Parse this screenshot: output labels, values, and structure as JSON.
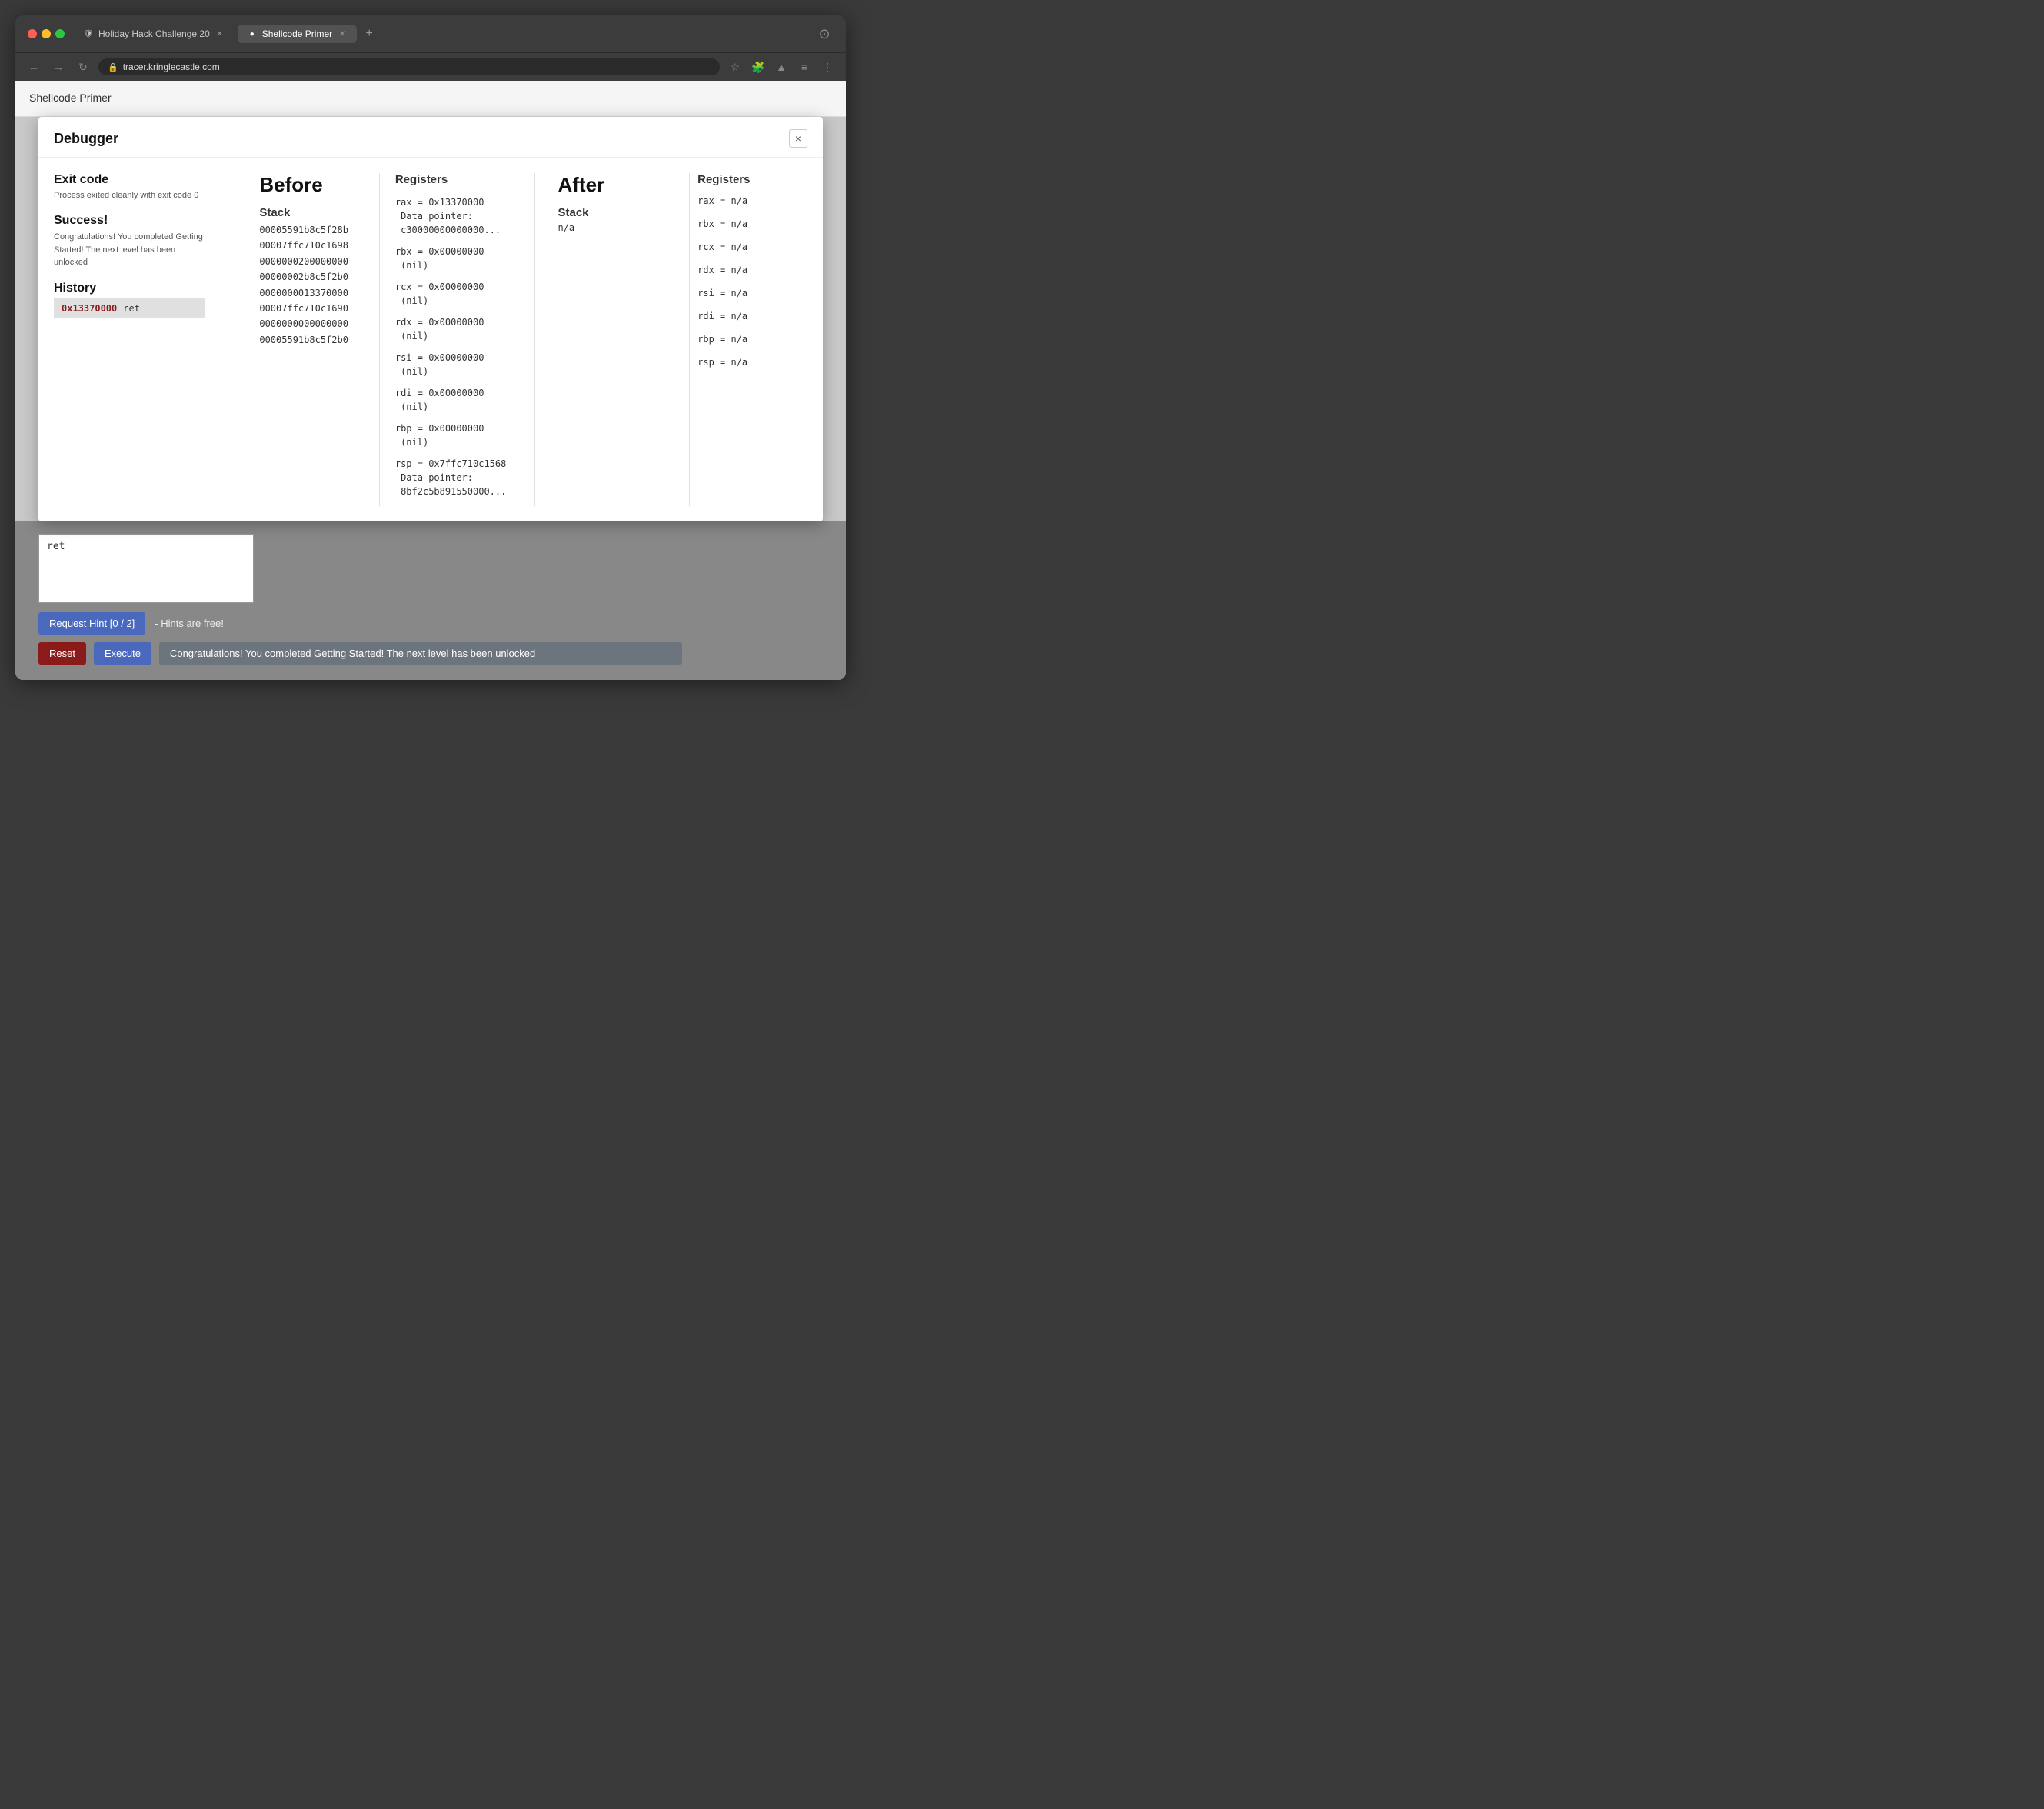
{
  "browser": {
    "tab1": {
      "label": "Holiday Hack Challenge 20",
      "favicon": "🛡",
      "active": false
    },
    "tab2": {
      "label": "Shellcode Primer",
      "favicon": "🔵",
      "active": true
    },
    "address": "tracer.kringlecastle.com",
    "nav": {
      "back": "←",
      "forward": "→",
      "reload": "↻"
    }
  },
  "sidebar": {
    "title": "Shellcode Primer"
  },
  "debugger": {
    "title": "Debugger",
    "close_label": "×",
    "exit_code": {
      "label": "Exit code",
      "value": "Process exited cleanly with exit code 0"
    },
    "success": {
      "label": "Success!",
      "value": "Congratulations! You completed Getting Started! The next level has been unlocked"
    },
    "history": {
      "label": "History",
      "items": [
        {
          "addr": "0x13370000",
          "instruction": "ret"
        }
      ]
    },
    "before": {
      "title": "Before",
      "stack_label": "Stack",
      "stack_values": [
        "00005591b8c5f28b",
        "00007ffc710c1698",
        "0000000200000000",
        "00000002b8c5f2b0",
        "0000000013370000",
        "00007ffc710c1690",
        "0000000000000000",
        "00005591b8c5f2b0"
      ]
    },
    "registers_before": {
      "label": "Registers",
      "entries": [
        {
          "name": "rax",
          "value": "0x13370000",
          "note": "Data pointer:",
          "data": "c30000000000000..."
        },
        {
          "name": "rbx",
          "value": "0x00000000",
          "note": "(nil)",
          "data": ""
        },
        {
          "name": "rcx",
          "value": "0x00000000",
          "note": "(nil)",
          "data": ""
        },
        {
          "name": "rdx",
          "value": "0x00000000",
          "note": "(nil)",
          "data": ""
        },
        {
          "name": "rsi",
          "value": "0x00000000",
          "note": "(nil)",
          "data": ""
        },
        {
          "name": "rdi",
          "value": "0x00000000",
          "note": "(nil)",
          "data": ""
        },
        {
          "name": "rbp",
          "value": "0x00000000",
          "note": "(nil)",
          "data": ""
        },
        {
          "name": "rsp",
          "value": "0x7ffc710c1568",
          "note": "Data pointer:",
          "data": "8bf2c5b891550000..."
        }
      ]
    },
    "after": {
      "title": "After",
      "stack_label": "Stack",
      "stack_value": "n/a"
    },
    "registers_after": {
      "label": "Registers",
      "entries": [
        {
          "name": "rax",
          "value": "n/a"
        },
        {
          "name": "rbx",
          "value": "n/a"
        },
        {
          "name": "rcx",
          "value": "n/a"
        },
        {
          "name": "rdx",
          "value": "n/a"
        },
        {
          "name": "rsi",
          "value": "n/a"
        },
        {
          "name": "rdi",
          "value": "n/a"
        },
        {
          "name": "rbp",
          "value": "n/a"
        },
        {
          "name": "rsp",
          "value": "n/a"
        }
      ]
    }
  },
  "bottom": {
    "code_value": "ret",
    "hint_btn": "Request Hint [0 / 2]",
    "hint_text": "- Hints are free!",
    "reset_btn": "Reset",
    "execute_btn": "Execute",
    "success_msg": "Congratulations! You completed Getting Started! The next level has been unlocked"
  }
}
